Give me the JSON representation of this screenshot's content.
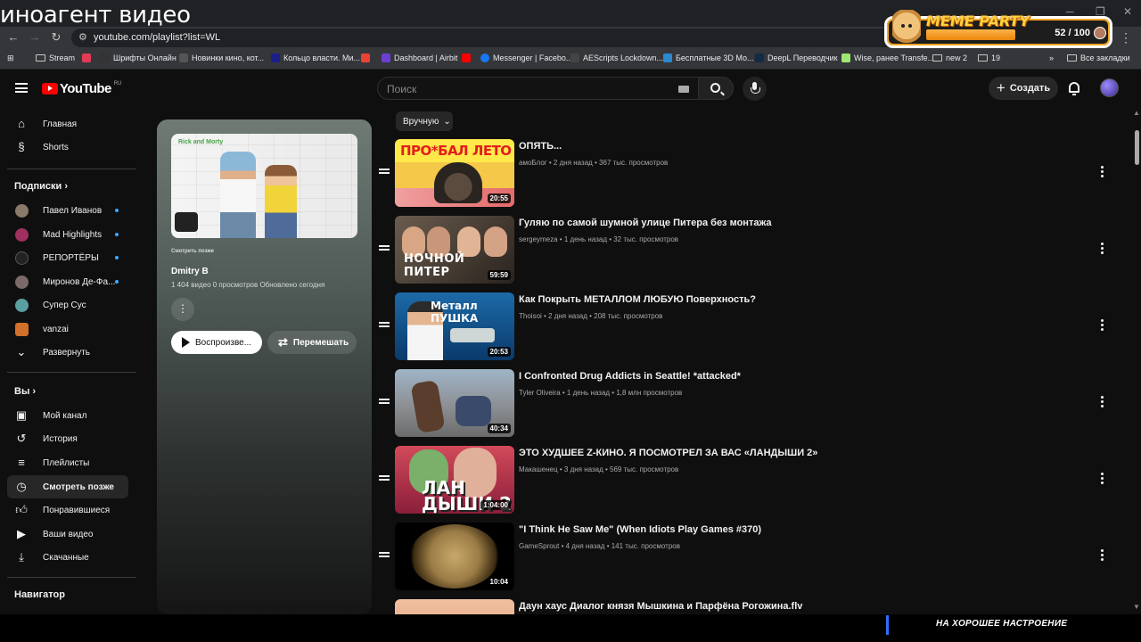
{
  "overlay": {
    "title": "иноагент видео"
  },
  "browser": {
    "url": "youtube.com/playlist?list=WL",
    "bookmarks": [
      "Stream",
      "Шрифты Онлайн",
      "Новинки кино, кот...",
      "Кольцо власти. Ми...",
      "Dashboard | Airbit",
      "Messenger | Facebo...",
      "AEScripts Lockdown...",
      "Бесплатные 3D Мо...",
      "DeepL Переводчик",
      "Wise, ранее Transfe...",
      "new 2",
      "19",
      "Все закладки"
    ]
  },
  "meme_widget": {
    "logo": "MEME PARTY",
    "count": "52 / 100"
  },
  "header": {
    "logo_text": "YouTube",
    "region": "RU",
    "search_placeholder": "Поиск",
    "create_label": "Создать"
  },
  "sidebar": {
    "main": [
      {
        "label": "Главная",
        "icon": "home-icon"
      },
      {
        "label": "Shorts",
        "icon": "shorts-icon"
      }
    ],
    "subscriptions_title": "Подписки",
    "subscriptions": [
      {
        "label": "Павел Иванов",
        "color": "#8a7a6a",
        "dot": true
      },
      {
        "label": "Mad Highlights",
        "color": "#a03060",
        "dot": true
      },
      {
        "label": "РЕПОРТЁРЫ",
        "color": "#222222",
        "dot": true
      },
      {
        "label": "Миронов Де-Фа...",
        "color": "#7a6a6a",
        "dot": true
      },
      {
        "label": "Супер Сус",
        "color": "#5aa0a0",
        "dot": false
      },
      {
        "label": "vanzai",
        "color": "#d0702a",
        "dot": false
      }
    ],
    "expand_label": "Развернуть",
    "you_title": "Вы",
    "you_items": [
      {
        "label": "Мой канал",
        "icon": "channel-icon",
        "active": false
      },
      {
        "label": "История",
        "icon": "history-icon",
        "active": false
      },
      {
        "label": "Плейлисты",
        "icon": "playlists-icon",
        "active": false
      },
      {
        "label": "Смотреть позже",
        "icon": "watch-later-icon",
        "active": true
      },
      {
        "label": "Понравившиеся",
        "icon": "like-icon",
        "active": false
      },
      {
        "label": "Ваши видео",
        "icon": "your-videos-icon",
        "active": false
      },
      {
        "label": "Скачанные",
        "icon": "download-icon",
        "active": false
      }
    ],
    "navigator_title": "Навигатор"
  },
  "playlist": {
    "subtitle": "Смотреть позже",
    "owner": "Dmitry B",
    "meta": "1 404 видео   0 просмотров   Обновлено сегодня",
    "thumb_text": "Rick and Morty",
    "play_label": "Воспроизве...",
    "shuffle_label": "Перемешать"
  },
  "sort_label": "Вручную",
  "videos": [
    {
      "title": "ОПЯТЬ...",
      "meta": "амоБлог • 2 дня назад • 367 тыс. просмотров",
      "duration": "20:55",
      "thumb_text": "ПРО*БАЛ ЛЕТО"
    },
    {
      "title": "Гуляю по самой шумной улице Питера без монтажа",
      "meta": "sergeymeza • 1 день назад • 32 тыс. просмотров",
      "duration": "59:59",
      "thumb_text": "НОЧНОЙ ПИТЕР"
    },
    {
      "title": "Как Покрыть МЕТАЛЛОМ ЛЮБУЮ Поверхность?",
      "meta": "Thoisoi • 2 дня назад • 208 тыс. просмотров",
      "duration": "20:53",
      "thumb_text": "Металл ПУШКА"
    },
    {
      "title": "I Confronted Drug Addicts in Seattle! *attacked*",
      "meta": "Tyler Oliveira • 1 день назад • 1,8 млн просмотров",
      "duration": "40:34",
      "thumb_text": ""
    },
    {
      "title": "ЭТО ХУДШЕЕ Z-КИНО. Я ПОСМОТРЕЛ ЗА ВАС «ЛАНДЫШИ 2»",
      "meta": "Макашенец • 3 дня назад • 569 тыс. просмотров",
      "duration": "1:04:00",
      "thumb_text": "ЛАН ДЫШИ 2"
    },
    {
      "title": "\"I Think He Saw Me\" (When Idiots Play Games #370)",
      "meta": "GameSprout • 4 дня назад • 141 тыс. просмотров",
      "duration": "10:04",
      "thumb_text": ""
    },
    {
      "title": "Даун хаус Диалог князя Мышкина и Парфёна Рогожина.flv",
      "meta": "",
      "duration": "",
      "thumb_text": ""
    }
  ],
  "bottom_bar": {
    "text": "НА ХОРОШЕЕ НАСТРОЕНИЕ"
  }
}
